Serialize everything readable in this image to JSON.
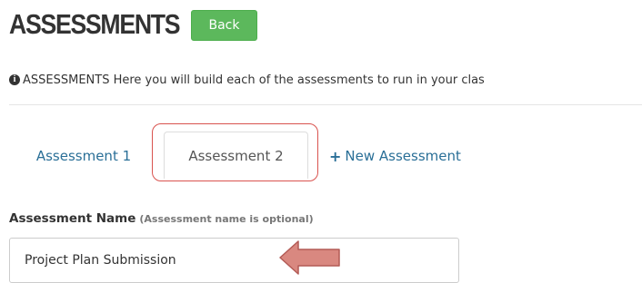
{
  "header": {
    "title": "ASSESSMENTS",
    "back_label": "Back"
  },
  "info": {
    "icon": "info-circle-icon",
    "text": "ASSESSMENTS Here you will build each of the assessments to run in your clas"
  },
  "tabs": [
    {
      "label": "Assessment 1",
      "active": false
    },
    {
      "label": "Assessment 2",
      "active": true
    },
    {
      "label": "New Assessment",
      "icon": "plus-icon"
    }
  ],
  "form": {
    "name_label": "Assessment Name",
    "name_hint": "(Assessment name is optional)",
    "name_value": "Project Plan Submission"
  },
  "colors": {
    "back_button": "#5cb85c",
    "link": "#2a6f97",
    "highlight": "#d9534f",
    "annotation_arrow": "#d98880"
  }
}
